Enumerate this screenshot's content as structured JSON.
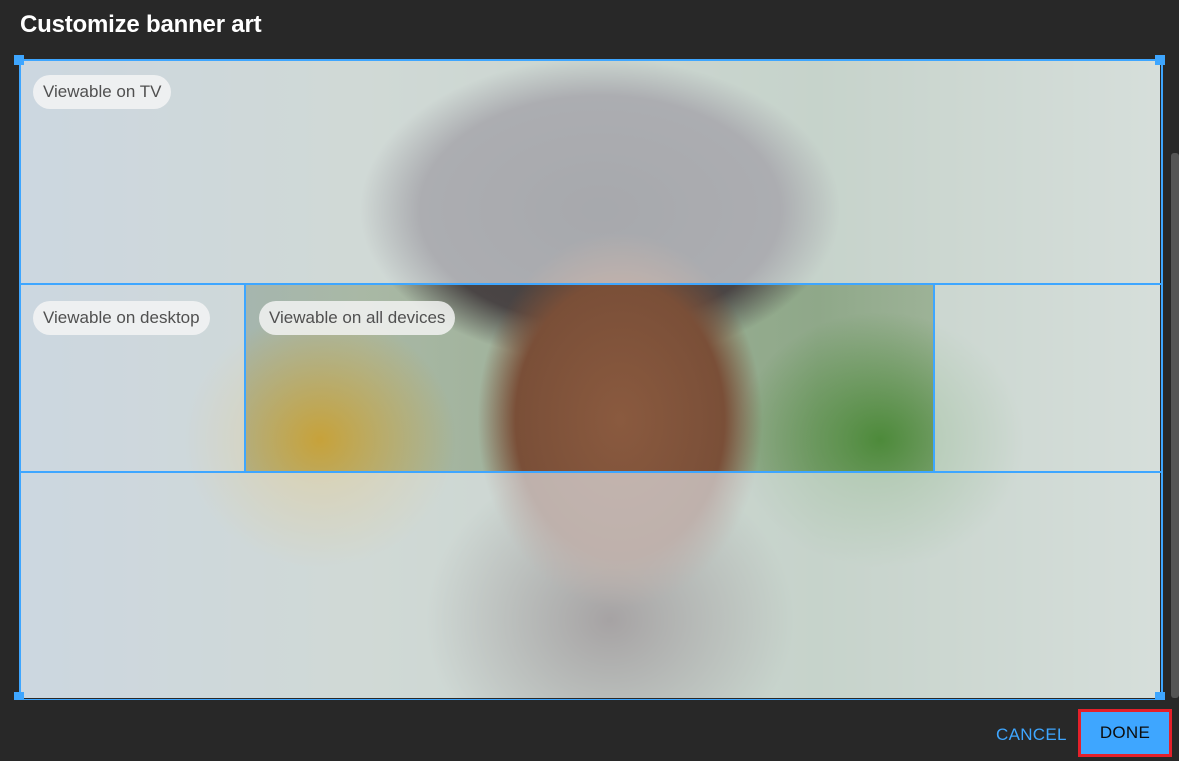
{
  "dialog": {
    "title": "Customize banner art"
  },
  "zones": {
    "tv_label": "Viewable on TV",
    "desktop_label": "Viewable on desktop",
    "all_devices_label": "Viewable on all devices"
  },
  "footer": {
    "cancel_label": "CANCEL",
    "done_label": "DONE"
  },
  "colors": {
    "accent": "#3ea6ff",
    "highlight": "#e5202a",
    "background": "#282828"
  },
  "icons": [
    "resize-handle-icon"
  ]
}
